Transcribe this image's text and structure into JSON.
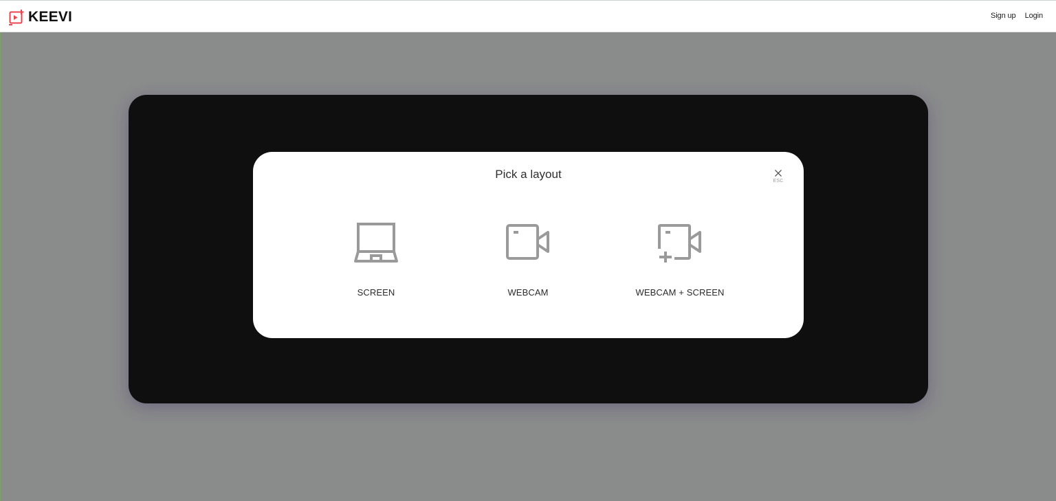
{
  "header": {
    "brand": "KEEVI",
    "signup_label": "Sign up",
    "login_label": "Login"
  },
  "modal": {
    "title": "Pick a layout",
    "close_hint": "ESC",
    "options": [
      {
        "label": "SCREEN",
        "icon": "laptop-icon"
      },
      {
        "label": "WEBCAM",
        "icon": "webcam-icon"
      },
      {
        "label": "WEBCAM + SCREEN",
        "icon": "webcam-screen-icon"
      }
    ]
  },
  "colors": {
    "brand_accent": "#e8454f",
    "backdrop": "#8a8b8b",
    "stage": "#0f0f10",
    "icon_gray": "#9a9a9a"
  }
}
